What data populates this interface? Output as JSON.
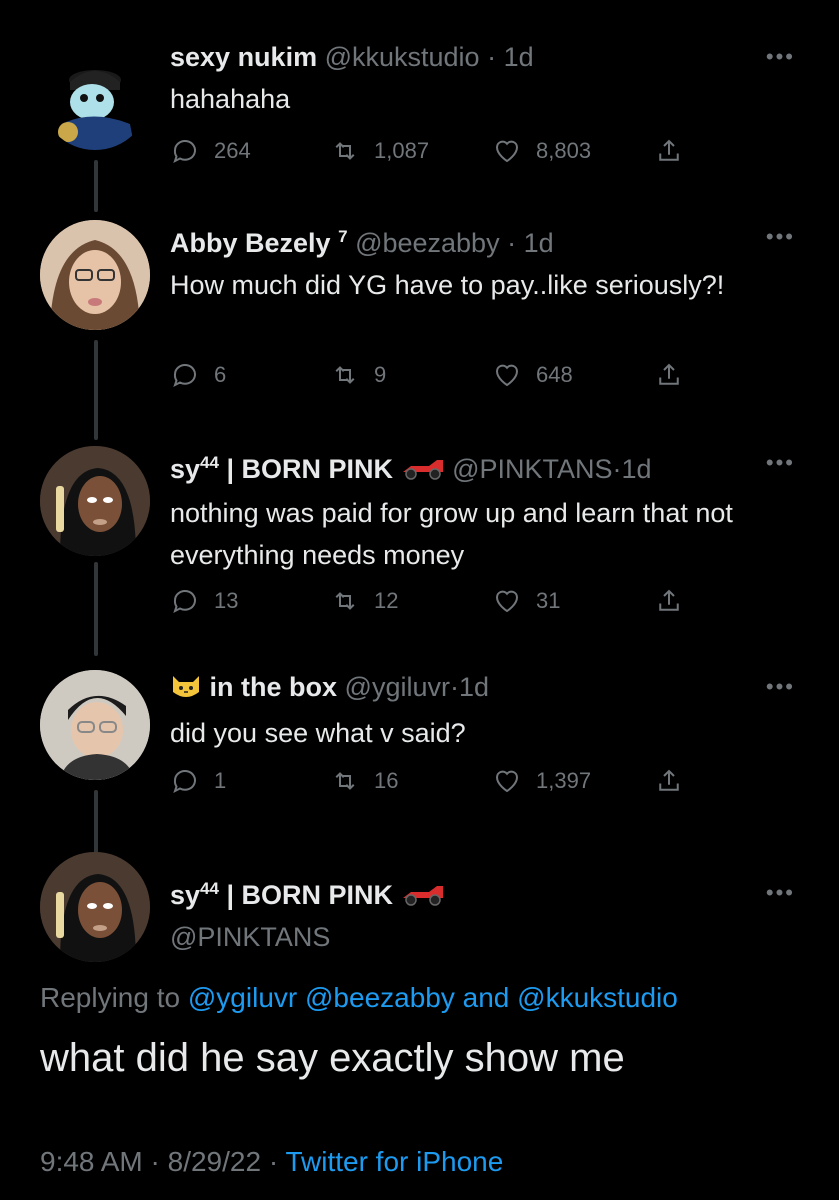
{
  "tweets": [
    {
      "name": "sexy nukim",
      "handle": "@kkukstudio",
      "time": "1d",
      "text": "hahahaha",
      "replies": "264",
      "retweets": "1,087",
      "likes": "8,803"
    },
    {
      "name": "Abby Bezely",
      "name_suffix": "7",
      "handle": "@beezabby",
      "time": "1d",
      "text": "How much did YG have to pay..like seriously?!",
      "replies": "6",
      "retweets": "9",
      "likes": "648"
    },
    {
      "name": "sy",
      "name_sup": "44",
      "name_rest": " | BORN PINK",
      "handle": "@PINKTANS",
      "time": "1d",
      "text": "nothing was paid for grow up and learn that not everything needs money",
      "replies": "13",
      "retweets": "12",
      "likes": "31"
    },
    {
      "name": "in the box",
      "handle": "@ygiluvr",
      "time": "1d",
      "text": "did you see what v said?",
      "replies": "1",
      "retweets": "16",
      "likes": "1,397"
    }
  ],
  "main": {
    "name": "sy",
    "name_sup": "44",
    "name_rest": " | BORN PINK",
    "handle": "@PINKTANS",
    "replying_label": "Replying to",
    "mention_1": "@ygiluvr",
    "mention_2": "@beezabby",
    "and_word": "and",
    "mention_3": "@kkukstudio",
    "text": "what did he say exactly show me",
    "time": "9:48 AM",
    "date": "8/29/22",
    "source": "Twitter for iPhone"
  },
  "sep": "·",
  "more_label": "•••",
  "icons": {
    "reply": "reply-icon",
    "retweet": "retweet-icon",
    "like": "heart-icon",
    "share": "share-icon",
    "racecar": "racing-car-emoji-icon",
    "cat": "cat-face-emoji-icon"
  },
  "colors": {
    "background": "#000000",
    "text": "#e7e9ea",
    "muted": "#71767b",
    "link": "#1d9bf0"
  }
}
